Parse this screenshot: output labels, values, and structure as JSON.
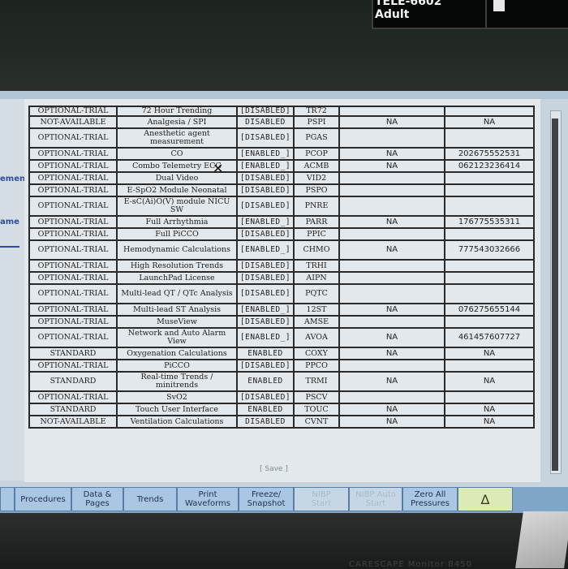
{
  "top_status": {
    "line1": "TELE-6602",
    "line2": "Adult"
  },
  "side_labels": [
    "ement",
    "ame"
  ],
  "table": {
    "partial_header_row": [
      "OPTIONAL-TRIAL",
      "72 Hour Trending",
      "[DISABLED]",
      "TR72",
      "",
      ""
    ],
    "rows": [
      [
        "NOT-AVAILABLE",
        "Analgesia / SPI",
        "DISABLED",
        "PSPI",
        "NA",
        "NA"
      ],
      [
        "OPTIONAL-TRIAL",
        "Anesthetic agent measurement",
        "[DISABLED]",
        "PGAS",
        "",
        ""
      ],
      [
        "OPTIONAL-TRIAL",
        "CO",
        "[ENABLED_]",
        "PCOP",
        "NA",
        "202675552531"
      ],
      [
        "OPTIONAL-TRIAL",
        "Combo Telemetry ECG",
        "[ENABLED_]",
        "ACMB",
        "NA",
        "062123236414"
      ],
      [
        "OPTIONAL-TRIAL",
        "Dual Video",
        "[DISABLED]",
        "VID2",
        "",
        ""
      ],
      [
        "OPTIONAL-TRIAL",
        "E-SpO2 Module Neonatal",
        "[DISABLED]",
        "PSPO",
        "",
        ""
      ],
      [
        "OPTIONAL-TRIAL",
        "E-sC(Ai)O(V) module NICU SW",
        "[DISABLED]",
        "PNRE",
        "",
        ""
      ],
      [
        "OPTIONAL-TRIAL",
        "Full Arrhythmia",
        "[ENABLED_]",
        "PARR",
        "NA",
        "176775535311"
      ],
      [
        "OPTIONAL-TRIAL",
        "Full PiCCO",
        "[DISABLED]",
        "PPIC",
        "",
        ""
      ],
      [
        "OPTIONAL-TRIAL",
        "Hemodynamic Calculations",
        "[ENABLED_]",
        "CHMO",
        "NA",
        "777543032666"
      ],
      [
        "OPTIONAL-TRIAL",
        "High Resolution Trends",
        "[DISABLED]",
        "TRHI",
        "",
        ""
      ],
      [
        "OPTIONAL-TRIAL",
        "LaunchPad License",
        "[DISABLED]",
        "AIPN",
        "",
        ""
      ],
      [
        "OPTIONAL-TRIAL",
        "Multi-lead QT / QTc Analysis",
        "[DISABLED]",
        "PQTC",
        "",
        ""
      ],
      [
        "OPTIONAL-TRIAL",
        "Multi-lead ST Analysis",
        "[ENABLED_]",
        "12ST",
        "NA",
        "076275655144"
      ],
      [
        "OPTIONAL-TRIAL",
        "MuseView",
        "[DISABLED]",
        "AMSE",
        "",
        ""
      ],
      [
        "OPTIONAL-TRIAL",
        "Network and Auto Alarm View",
        "[ENABLED_]",
        "AVOA",
        "NA",
        "461457607727"
      ],
      [
        "STANDARD",
        "Oxygenation Calculations",
        "ENABLED",
        "COXY",
        "NA",
        "NA"
      ],
      [
        "OPTIONAL-TRIAL",
        "PiCCO",
        "[DISABLED]",
        "PPCO",
        "",
        ""
      ],
      [
        "STANDARD",
        "Real-time Trends / minitrends",
        "ENABLED",
        "TRMI",
        "NA",
        "NA"
      ],
      [
        "OPTIONAL-TRIAL",
        "SvO2",
        "[DISABLED]",
        "PSCV",
        "",
        ""
      ],
      [
        "STANDARD",
        "Touch User Interface",
        "ENABLED",
        "TOUC",
        "NA",
        "NA"
      ],
      [
        "NOT-AVAILABLE",
        "Ventilation Calculations",
        "DISABLED",
        "CVNT",
        "NA",
        "NA"
      ]
    ]
  },
  "save_label": "[ Save ]",
  "bottom_bar": {
    "procedures": "Procedures",
    "data_pages_1": "Data &",
    "data_pages_2": "Pages",
    "trends": "Trends",
    "print_1": "Print",
    "print_2": "Waveforms",
    "freeze_1": "Freeze/",
    "freeze_2": "Snapshot",
    "nibp_start_1": "NIBP",
    "nibp_start_2": "Start",
    "nibp_auto_1": "NIBP Auto",
    "nibp_auto_2": "Start",
    "zero_1": "Zero All",
    "zero_2": "Pressures",
    "alarm_icon": "∆"
  },
  "bezel_brand": "CARESCAPE Monitor B450"
}
